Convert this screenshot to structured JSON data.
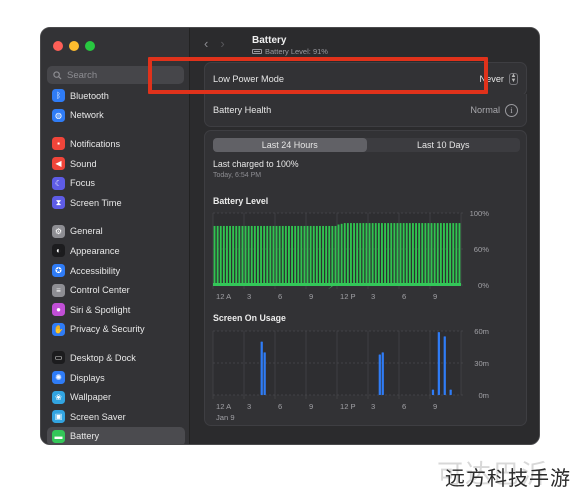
{
  "window": {
    "traffic_colors": [
      "#fe5f57",
      "#febc2e",
      "#28c840"
    ]
  },
  "sidebar": {
    "search_placeholder": "Search",
    "items": [
      {
        "label": "Bluetooth",
        "icon": "bluetooth-icon",
        "color": "#2f7cf6",
        "glyph": "ᛒ"
      },
      {
        "label": "Network",
        "icon": "globe-icon",
        "color": "#2f7cf6",
        "glyph": "◍"
      },
      {
        "label": "Notifications",
        "icon": "bell-icon",
        "color": "#f0453a",
        "glyph": "▪"
      },
      {
        "label": "Sound",
        "icon": "speaker-icon",
        "color": "#f0453a",
        "glyph": "◀"
      },
      {
        "label": "Focus",
        "icon": "moon-icon",
        "color": "#5e5ce6",
        "glyph": "☾"
      },
      {
        "label": "Screen Time",
        "icon": "hourglass-icon",
        "color": "#5e5ce6",
        "glyph": "⧗"
      },
      {
        "label": "General",
        "icon": "gear-icon",
        "color": "#8e8e93",
        "glyph": "⚙"
      },
      {
        "label": "Appearance",
        "icon": "appearance-icon",
        "color": "#1c1c1e",
        "glyph": "◐"
      },
      {
        "label": "Accessibility",
        "icon": "accessibility-icon",
        "color": "#2f7cf6",
        "glyph": "✪"
      },
      {
        "label": "Control Center",
        "icon": "control-center-icon",
        "color": "#8e8e93",
        "glyph": "≡"
      },
      {
        "label": "Siri & Spotlight",
        "icon": "siri-icon",
        "color": "#c14fd6",
        "glyph": "●"
      },
      {
        "label": "Privacy & Security",
        "icon": "hand-icon",
        "color": "#2f7cf6",
        "glyph": "✋"
      },
      {
        "label": "Desktop & Dock",
        "icon": "dock-icon",
        "color": "#1c1c1e",
        "glyph": "▭"
      },
      {
        "label": "Displays",
        "icon": "sun-icon",
        "color": "#2f7cf6",
        "glyph": "✺"
      },
      {
        "label": "Wallpaper",
        "icon": "wallpaper-icon",
        "color": "#32a4e0",
        "glyph": "❀"
      },
      {
        "label": "Screen Saver",
        "icon": "screen-saver-icon",
        "color": "#32a4e0",
        "glyph": "▣"
      },
      {
        "label": "Battery",
        "icon": "battery-icon",
        "color": "#34c759",
        "glyph": "▬"
      }
    ]
  },
  "header": {
    "title": "Battery",
    "subtitle": "Battery Level: 91%"
  },
  "settings": {
    "low_power_label": "Low Power Mode",
    "low_power_value": "Never",
    "health_label": "Battery Health",
    "health_value": "Normal"
  },
  "usage": {
    "tabs": [
      "Last 24 Hours",
      "Last 10 Days"
    ],
    "selected_tab": 0,
    "charged_text": "Last charged to 100%",
    "charged_time": "Today, 6:54 PM"
  },
  "chart_data": [
    {
      "type": "bar",
      "title": "Battery Level",
      "y_ticks": [
        "100%",
        "60%",
        "0%"
      ],
      "ylim": [
        0,
        100
      ],
      "x_ticks": [
        "12 A",
        "3",
        "6",
        "9",
        "12 P",
        "3",
        "6",
        "9"
      ],
      "values": [
        82,
        82,
        82,
        82,
        82,
        82,
        82,
        82,
        82,
        82,
        82,
        82,
        82,
        82,
        82,
        82,
        82,
        82,
        82,
        82,
        82,
        82,
        82,
        82,
        82,
        82,
        82,
        82,
        82,
        82,
        82,
        82,
        82,
        82,
        82,
        82,
        82,
        82,
        82,
        82,
        84,
        85,
        86,
        86,
        86,
        86,
        86,
        86,
        86,
        86,
        86,
        86,
        86,
        86,
        86,
        86,
        86,
        86,
        86,
        86,
        86,
        86,
        86,
        86,
        86,
        86,
        86,
        86,
        86,
        86,
        86,
        86,
        86,
        86,
        86,
        86,
        86,
        86,
        86,
        86
      ],
      "charging_color": "#34c759",
      "bar_color": "#30c450"
    },
    {
      "type": "bar",
      "title": "Screen On Usage",
      "y_ticks": [
        "60m",
        "30m",
        "0m"
      ],
      "ylim": [
        0,
        60
      ],
      "x_ticks": [
        "12 A",
        "3",
        "6",
        "9",
        "12 P",
        "3",
        "6",
        "9"
      ],
      "x_sub": "Jan 9",
      "values": [
        0,
        0,
        0,
        0,
        0,
        0,
        0,
        0,
        0,
        0,
        0,
        0,
        0,
        0,
        0,
        0,
        50,
        40,
        0,
        0,
        0,
        0,
        0,
        0,
        0,
        0,
        0,
        0,
        0,
        0,
        0,
        0,
        0,
        0,
        0,
        0,
        0,
        0,
        0,
        0,
        0,
        0,
        0,
        0,
        0,
        0,
        0,
        0,
        0,
        0,
        0,
        0,
        0,
        0,
        0,
        0,
        38,
        40,
        0,
        0,
        0,
        0,
        0,
        0,
        0,
        0,
        0,
        0,
        0,
        0,
        0,
        0,
        0,
        0,
        5,
        0,
        59,
        0,
        55,
        0,
        5,
        0,
        0,
        0
      ],
      "bar_color": "#2f7cf6"
    }
  ],
  "watermark": {
    "text": "远方科技手游",
    "ghost": "可达巴沂"
  }
}
